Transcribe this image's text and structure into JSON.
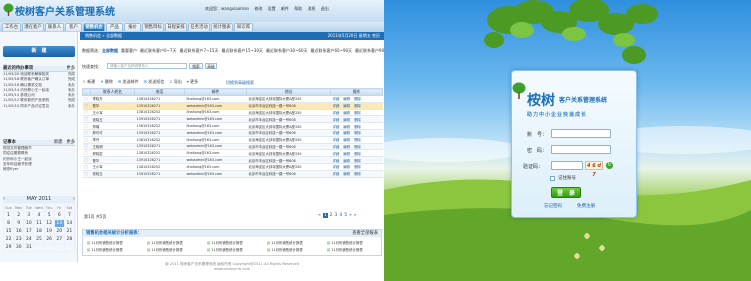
{
  "crm": {
    "app_title": "桉树客户关系管理系统",
    "top": {
      "welcome": "欢迎您：wangxiaoman",
      "items": [
        "修改",
        "设置",
        "邮件",
        "帮助",
        "消息",
        "退出"
      ]
    },
    "tabs": [
      "工作台",
      "潜在客户",
      "联系人",
      "客户",
      "销售机会",
      "产品",
      "报价",
      "销售目标",
      "日程安排",
      "任务活动",
      "统计图表",
      "知识库"
    ],
    "active_tab": "销售机会",
    "breadcrumb": "销售机会 » 全部数据",
    "date_text": "2011年5月20日 星期五  农历 ",
    "new_button": "新　建",
    "recent": {
      "title": "最近的待办事项",
      "more": "更多",
      "rows": [
        {
          "date": "11/05/20",
          "text": "电话联系解释相关",
          "status": "完成"
        },
        {
          "date": "11/05/18",
          "text": "联系客户确认订单",
          "status": "完成"
        },
        {
          "date": "11/05/16",
          "text": "确认需求文档",
          "status": "未办"
        },
        {
          "date": "11/05/14",
          "text": "约外联小王一起谈",
          "status": "未办"
        },
        {
          "date": "11/05/13",
          "text": "参观公司",
          "status": "未办"
        },
        {
          "date": "11/05/12",
          "text": "联系新的产品采购",
          "status": "完成"
        },
        {
          "date": "11/05/10",
          "text": "同本产品讨论意见",
          "status": "未办"
        }
      ]
    },
    "notes": {
      "title": "记事本",
      "actions": [
        "新建",
        "更多"
      ],
      "rows": [
        "规范文件管理细节",
        "同往往期费联系",
        "约外科小王一起谈",
        "至年科目细节处理",
        "修改flyer"
      ]
    },
    "calendar": {
      "month": "MAY 2011",
      "weekdays": [
        "Sun",
        "Mon",
        "Tue",
        "Wed",
        "Thu",
        "Fri",
        "Sat"
      ],
      "days": [
        "1",
        "2",
        "3",
        "4",
        "5",
        "6",
        "7",
        "8",
        "9",
        "10",
        "11",
        "12",
        "13",
        "14",
        "15",
        "16",
        "17",
        "18",
        "19",
        "20",
        "21",
        "22",
        "23",
        "24",
        "25",
        "26",
        "27",
        "28",
        "29",
        "30",
        "31"
      ],
      "selected": "13"
    },
    "filter": {
      "label": "数据筛选：",
      "items": [
        "全部数据",
        "重要客户",
        "最近联系客户0~7天",
        "最近联系客户7~15天",
        "最近联系客户15~30天",
        "最近联系客户30~60天",
        "最近联系客户60~90天",
        "最近联系客户90天以上"
      ]
    },
    "search": {
      "label": "快速查找：",
      "placeholder": "请输入客户名称或联系人",
      "button": "搜索",
      "advanced": "高级"
    },
    "toolbar": [
      "新建",
      "删除",
      "发送邮件",
      "发送短信",
      "导出",
      "更多"
    ],
    "link_toggle": "切换到高级搜索",
    "grid": {
      "headers": [
        "",
        "联系人姓名",
        "电话",
        "邮件",
        "地址",
        "操作"
      ],
      "rows": [
        {
          "name": "李晓东",
          "tel": "13810326271",
          "mail": "lihaitong@163.com",
          "addr": "北京海淀区大钟寺国际大厦A座330",
          "hl": false
        },
        {
          "name": "曹华",
          "tel": "13910326271",
          "mail": "webadmin@163.com",
          "addr": "北京市丰台区科技一路一号608",
          "hl": true
        },
        {
          "name": "王小军",
          "tel": "13810326252",
          "mail": "lihaitong@163.com",
          "addr": "北京海淀区大钟寺国际大厦A座330",
          "hl": false
        },
        {
          "name": "张晓玉",
          "tel": "13910326271",
          "mail": "webadmin@163.com",
          "addr": "北京市丰台区科技一路一号608",
          "hl": false
        },
        {
          "name": "郑娟",
          "tel": "13810326252",
          "mail": "lihaitong@163.com",
          "addr": "北京海淀区大钟寺国际大厦A座330",
          "hl": false
        },
        {
          "name": "邢可可",
          "tel": "13910326271",
          "mail": "webadmin@163.com",
          "addr": "北京市丰台区科技一路一号608",
          "hl": false
        },
        {
          "name": "李丹",
          "tel": "13810326252",
          "mail": "lihaitong@163.com",
          "addr": "北京海淀区大钟寺国际大厦A座330",
          "hl": false
        },
        {
          "name": "王晓明",
          "tel": "13910326271",
          "mail": "webadmin@163.com",
          "addr": "北京市丰台区科技一路一号608",
          "hl": false
        },
        {
          "name": "邢晓宏",
          "tel": "13810326252",
          "mail": "lihaitong@163.com",
          "addr": "北京海淀区大钟寺国际大厦A座330",
          "hl": false
        },
        {
          "name": "曹华",
          "tel": "13910326271",
          "mail": "webadmin@163.com",
          "addr": "北京市丰台区科技一路一号608",
          "hl": false
        },
        {
          "name": "王小军",
          "tel": "13810326252",
          "mail": "lihaitong@163.com",
          "addr": "北京海淀区大钟寺国际大厦A座330",
          "hl": false
        },
        {
          "name": "张晓玉",
          "tel": "13910326271",
          "mail": "webadmin@163.com",
          "addr": "北京市丰台区科技一路一号608",
          "hl": false
        }
      ],
      "ops": [
        "详细",
        "编辑",
        "删除"
      ]
    },
    "pager": {
      "total": "第1页 共5页",
      "pages": [
        "«",
        "1",
        "2",
        "3",
        "4",
        "5",
        "»",
        "»"
      ],
      "current": "1"
    },
    "reports": {
      "title": "销售机会相关统计分析报表：",
      "more": "查看全部报表",
      "items": [
        "11月份销售统计报表",
        "11月份销售统计报表",
        "11月份销售统计报表",
        "11月份销售统计报表",
        "11月份销售统计报表",
        "11月份销售统计报表",
        "11月份销售统计报表",
        "11月份销售统计报表",
        "11月份销售统计报表",
        "11月份销售统计报表"
      ]
    },
    "footer": [
      "版 2011 桉树客户关系管理系统 版权所有  Copyright@2011 All Rights Reserved",
      "www.anshucrm.com"
    ]
  },
  "login": {
    "brand": "桉树",
    "brand_sub": "客户关系管理系统",
    "slogan": "助力中小企业快速成长",
    "account_label": "账　号：",
    "password_label": "密　码：",
    "captcha_label": "验证码：",
    "captcha_text": "4 6 d 7",
    "remember": "记住账号",
    "login_button": "登　录",
    "forgot": "忘记密码",
    "register": "免费注册"
  }
}
